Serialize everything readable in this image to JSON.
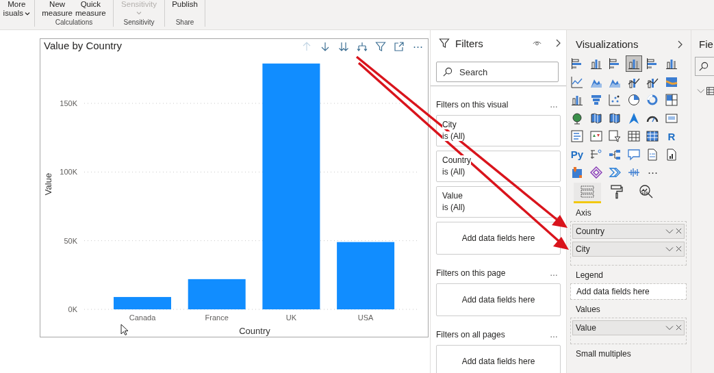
{
  "ribbon": {
    "groups": [
      {
        "buttons": [
          {
            "top": "More",
            "bottom": "isuals",
            "dropdown": true,
            "disabled": false
          }
        ]
      },
      {
        "label": "Calculations",
        "buttons": [
          {
            "top": "New",
            "bottom": "measure",
            "dropdown": false,
            "disabled": false
          },
          {
            "top": "Quick",
            "bottom": "measure",
            "dropdown": false,
            "disabled": false
          }
        ]
      },
      {
        "label": "Sensitivity",
        "buttons": [
          {
            "top": "Sensitivity",
            "dropdown": true,
            "disabled": true
          }
        ]
      },
      {
        "label": "Share",
        "buttons": [
          {
            "top": "Publish",
            "dropdown": false,
            "disabled": false
          }
        ]
      }
    ]
  },
  "visual": {
    "toolbar": [
      {
        "kind": "drill-up",
        "disabled": true
      },
      {
        "kind": "drill-down",
        "disabled": false
      },
      {
        "kind": "next-level",
        "disabled": false
      },
      {
        "kind": "expand-hierarchy",
        "disabled": false
      },
      {
        "kind": "filter",
        "disabled": false
      },
      {
        "kind": "focus",
        "disabled": false
      },
      {
        "kind": "more",
        "label": "⋯",
        "disabled": false
      }
    ],
    "chart_data": {
      "type": "bar",
      "title": "Value by Country",
      "xlabel": "Country",
      "ylabel": "Value",
      "categories": [
        "Canada",
        "France",
        "UK",
        "USA"
      ],
      "values": [
        9000,
        22000,
        179000,
        49000
      ],
      "grid": true,
      "ylim": [
        0,
        180000
      ],
      "yticks": [
        {
          "value": 0,
          "label": "0K"
        },
        {
          "value": 50000,
          "label": "50K"
        },
        {
          "value": 100000,
          "label": "100K"
        },
        {
          "value": 150000,
          "label": "150K"
        }
      ]
    }
  },
  "filters": {
    "title": "Filters",
    "search": {
      "placeholder": "Search"
    },
    "sections": [
      {
        "title": "Filters on this visual",
        "more": "…",
        "cards": [
          {
            "name": "City",
            "condition": "is (All)"
          },
          {
            "name": "Country",
            "condition": "is (All)"
          },
          {
            "name": "Value",
            "condition": "is (All)"
          }
        ],
        "drop": "Add data fields here"
      },
      {
        "title": "Filters on this page",
        "more": "…",
        "drop": "Add data fields here"
      },
      {
        "title": "Filters on all pages",
        "more": "…",
        "drop": "Add data fields here"
      }
    ]
  },
  "visualizations": {
    "title": "Visualizations",
    "gallery": [
      {
        "kind": "hbar",
        "selected": false
      },
      {
        "kind": "vbar",
        "selected": false
      },
      {
        "kind": "hbar",
        "selected": false
      },
      {
        "kind": "vbar",
        "selected": true
      },
      {
        "kind": "hbar",
        "selected": false
      },
      {
        "kind": "vbar",
        "selected": false
      },
      {
        "kind": "line",
        "selected": false
      },
      {
        "kind": "area",
        "selected": false
      },
      {
        "kind": "area",
        "selected": false
      },
      {
        "kind": "combo",
        "selected": false
      },
      {
        "kind": "combo",
        "selected": false
      },
      {
        "kind": "ribbon",
        "selected": false
      },
      {
        "kind": "vbar",
        "selected": false
      },
      {
        "kind": "funnel",
        "selected": false
      },
      {
        "kind": "scatter",
        "selected": false
      },
      {
        "kind": "pie",
        "selected": false
      },
      {
        "kind": "donut",
        "selected": false
      },
      {
        "kind": "treemap",
        "selected": false
      },
      {
        "kind": "globe",
        "selected": false
      },
      {
        "kind": "map",
        "selected": false
      },
      {
        "kind": "map",
        "selected": false
      },
      {
        "kind": "nav",
        "selected": false
      },
      {
        "kind": "gauge",
        "selected": false
      },
      {
        "kind": "card",
        "selected": false
      },
      {
        "kind": "list",
        "selected": false
      },
      {
        "kind": "kpi",
        "selected": false
      },
      {
        "kind": "slicer",
        "selected": false
      },
      {
        "kind": "table",
        "selected": false
      },
      {
        "kind": "matrix",
        "selected": false
      },
      {
        "kind": "text",
        "label": "R",
        "selected": false
      },
      {
        "kind": "text",
        "label": "Py",
        "selected": false
      },
      {
        "kind": "keyinf",
        "selected": false
      },
      {
        "kind": "tree",
        "selected": false
      },
      {
        "kind": "speech",
        "selected": false
      },
      {
        "kind": "doc",
        "selected": false
      },
      {
        "kind": "report",
        "selected": false
      },
      {
        "kind": "pin",
        "selected": false
      },
      {
        "kind": "diamond",
        "selected": false
      },
      {
        "kind": "chevrons",
        "selected": false
      },
      {
        "kind": "wave",
        "selected": false
      },
      {
        "kind": "more",
        "label": "⋯",
        "selected": false
      }
    ],
    "pane_tabs": [
      {
        "kind": "fields",
        "selected": true
      },
      {
        "kind": "format",
        "selected": false
      },
      {
        "kind": "analytics",
        "selected": false
      }
    ],
    "wells": [
      {
        "title": "Axis",
        "fields": [
          {
            "name": "Country"
          },
          {
            "name": "City"
          }
        ]
      },
      {
        "title": "Legend",
        "drop": "Add data fields here"
      },
      {
        "title": "Values",
        "fields": [
          {
            "name": "Value"
          }
        ]
      },
      {
        "title": "Small multiples"
      }
    ]
  },
  "fields_pane": {
    "title": "Fie"
  }
}
